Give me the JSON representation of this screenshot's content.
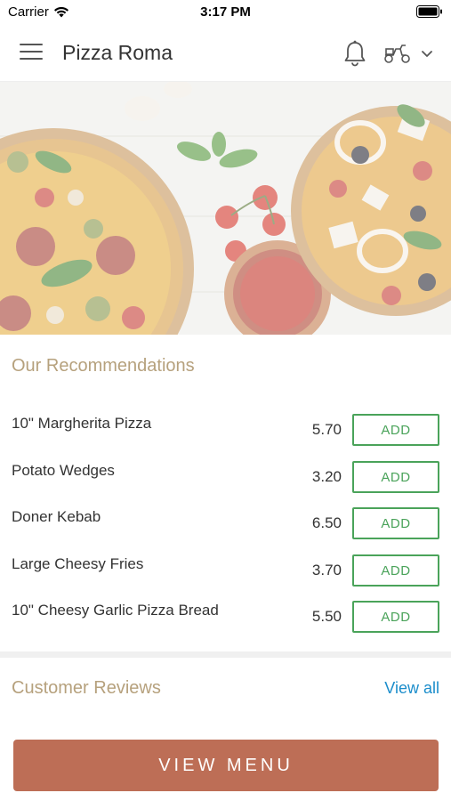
{
  "status_bar": {
    "carrier": "Carrier",
    "time": "3:17 PM"
  },
  "header": {
    "title": "Pizza Roma",
    "icons": [
      "menu-icon",
      "bell-icon",
      "scooter-icon",
      "chevron-down-icon"
    ]
  },
  "recommendations": {
    "heading": "Our Recommendations",
    "items": [
      {
        "name": "10\" Margherita Pizza",
        "price": "5.70",
        "button": "ADD"
      },
      {
        "name": "Potato Wedges",
        "price": "3.20",
        "button": "ADD"
      },
      {
        "name": "Doner Kebab",
        "price": "6.50",
        "button": "ADD"
      },
      {
        "name": "Large Cheesy Fries",
        "price": "3.70",
        "button": "ADD"
      },
      {
        "name": "10\" Cheesy Garlic Pizza Bread",
        "price": "5.50",
        "button": "ADD"
      }
    ]
  },
  "reviews": {
    "heading": "Customer Reviews",
    "view_all": "View all"
  },
  "footer": {
    "view_menu": "VIEW MENU"
  },
  "colors": {
    "accent_heading": "#b6a17d",
    "add_green": "#4aa35a",
    "link_blue": "#1b8dcb",
    "primary_button": "#bd6e56"
  }
}
